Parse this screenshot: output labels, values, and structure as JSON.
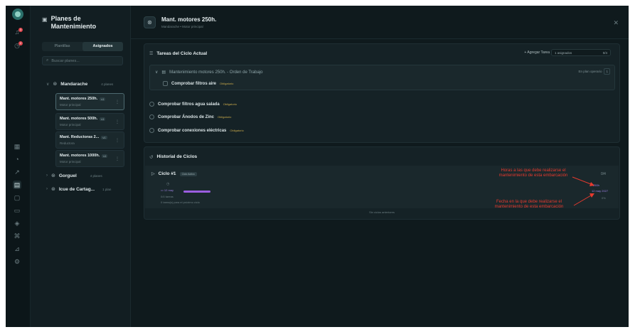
{
  "rail": {
    "icons": [
      "app-logo",
      "bell-icon",
      "clock-icon",
      "grid-icon",
      "compass-icon",
      "wrench-icon",
      "clipboard-icon",
      "box-icon",
      "folder-icon",
      "shield-icon",
      "tools-icon",
      "chart-icon",
      "settings-icon"
    ],
    "notifications": [
      "3",
      "2"
    ]
  },
  "sidebar": {
    "title": "Planes de Mantenimiento",
    "tabs": [
      "Plantillas",
      "Asignados"
    ],
    "active_tab": "Asignados",
    "search_placeholder": "Buscar planes...",
    "groups": [
      {
        "name": "Mandarache",
        "count": "4 planes",
        "expanded": true,
        "plans": [
          {
            "name": "Mant. motores 250h.",
            "version": "v1",
            "sub": "Motor principal",
            "selected": true
          },
          {
            "name": "Mant. motores 500h.",
            "version": "v1",
            "sub": "Motor principal",
            "selected": false
          },
          {
            "name": "Mant. Reductoras 2...",
            "version": "v1",
            "sub": "Reductora",
            "selected": false
          },
          {
            "name": "Mant. motores 1000h.",
            "version": "v1",
            "sub": "Motor principal",
            "selected": false
          }
        ]
      },
      {
        "name": "Gorguel",
        "count": "4 planes",
        "expanded": false
      },
      {
        "name": "Icue de Cartag...",
        "count": "1 plan",
        "expanded": false
      }
    ]
  },
  "header": {
    "title": "Mant. motores 250h.",
    "subtitle": "Mandarache • Motor principal"
  },
  "tasks_card": {
    "title": "Tareas del Ciclo Actual",
    "add_label": "+ Agregar Tarea",
    "assign_label": "1 asignados",
    "assign_count": "0/4",
    "work_order": {
      "label": "Mantenimiento motores 250h. - Orden de Trabajo",
      "status": "En plan operario",
      "status_num": "1",
      "task": {
        "label": "Comprobar filtros aire",
        "tag": "Obligatorio"
      }
    },
    "tasks": [
      {
        "label": "Comprobar filtros agua salada",
        "tag": "Obligatorio"
      },
      {
        "label": "Comprobar Ánodos de Zinc",
        "tag": "Obligatorio"
      },
      {
        "label": "Comprobar conexiones eléctricas",
        "tag": "Obligatorio"
      }
    ]
  },
  "history_card": {
    "title": "Historial de Ciclos",
    "cycle": {
      "name": "Ciclo #1",
      "badge": "Ciclo Activo",
      "fraction": "0/4",
      "date_label": "12 may",
      "hours_label": "0/4 tareas",
      "note": "0 tarea(s) para el próximo ciclo",
      "hours_value": "250h",
      "date_value": "12 may 2027",
      "percent": "0%"
    },
    "older_label": "Sin ciclos anteriores",
    "annotations": {
      "hours": "Horas a las que debe realizarse el mantenimiento de esta embarcación",
      "date": "Fecha en la que debe realizarse el mantenimiento de esta embarcación"
    }
  },
  "colors": {
    "accent": "#9b5ee0",
    "annotation": "#e63a2e",
    "background": "#0f1a1d"
  }
}
